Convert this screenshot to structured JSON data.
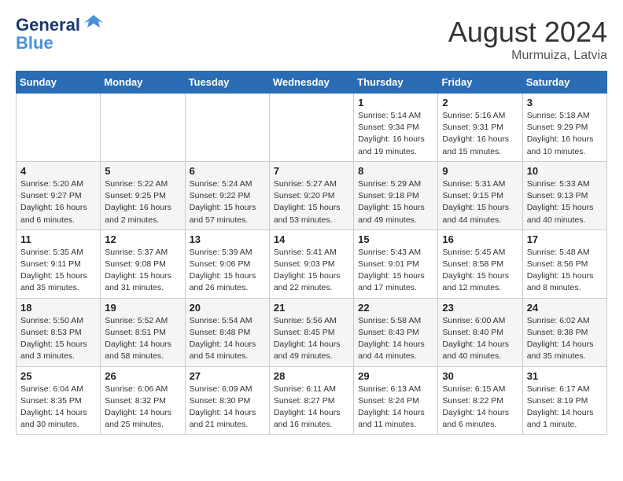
{
  "header": {
    "logo_line1": "General",
    "logo_line2": "Blue",
    "month_title": "August 2024",
    "location": "Murmuiza, Latvia"
  },
  "weekdays": [
    "Sunday",
    "Monday",
    "Tuesday",
    "Wednesday",
    "Thursday",
    "Friday",
    "Saturday"
  ],
  "weeks": [
    [
      {
        "day": "",
        "info": ""
      },
      {
        "day": "",
        "info": ""
      },
      {
        "day": "",
        "info": ""
      },
      {
        "day": "",
        "info": ""
      },
      {
        "day": "1",
        "info": "Sunrise: 5:14 AM\nSunset: 9:34 PM\nDaylight: 16 hours\nand 19 minutes."
      },
      {
        "day": "2",
        "info": "Sunrise: 5:16 AM\nSunset: 9:31 PM\nDaylight: 16 hours\nand 15 minutes."
      },
      {
        "day": "3",
        "info": "Sunrise: 5:18 AM\nSunset: 9:29 PM\nDaylight: 16 hours\nand 10 minutes."
      }
    ],
    [
      {
        "day": "4",
        "info": "Sunrise: 5:20 AM\nSunset: 9:27 PM\nDaylight: 16 hours\nand 6 minutes."
      },
      {
        "day": "5",
        "info": "Sunrise: 5:22 AM\nSunset: 9:25 PM\nDaylight: 16 hours\nand 2 minutes."
      },
      {
        "day": "6",
        "info": "Sunrise: 5:24 AM\nSunset: 9:22 PM\nDaylight: 15 hours\nand 57 minutes."
      },
      {
        "day": "7",
        "info": "Sunrise: 5:27 AM\nSunset: 9:20 PM\nDaylight: 15 hours\nand 53 minutes."
      },
      {
        "day": "8",
        "info": "Sunrise: 5:29 AM\nSunset: 9:18 PM\nDaylight: 15 hours\nand 49 minutes."
      },
      {
        "day": "9",
        "info": "Sunrise: 5:31 AM\nSunset: 9:15 PM\nDaylight: 15 hours\nand 44 minutes."
      },
      {
        "day": "10",
        "info": "Sunrise: 5:33 AM\nSunset: 9:13 PM\nDaylight: 15 hours\nand 40 minutes."
      }
    ],
    [
      {
        "day": "11",
        "info": "Sunrise: 5:35 AM\nSunset: 9:11 PM\nDaylight: 15 hours\nand 35 minutes."
      },
      {
        "day": "12",
        "info": "Sunrise: 5:37 AM\nSunset: 9:08 PM\nDaylight: 15 hours\nand 31 minutes."
      },
      {
        "day": "13",
        "info": "Sunrise: 5:39 AM\nSunset: 9:06 PM\nDaylight: 15 hours\nand 26 minutes."
      },
      {
        "day": "14",
        "info": "Sunrise: 5:41 AM\nSunset: 9:03 PM\nDaylight: 15 hours\nand 22 minutes."
      },
      {
        "day": "15",
        "info": "Sunrise: 5:43 AM\nSunset: 9:01 PM\nDaylight: 15 hours\nand 17 minutes."
      },
      {
        "day": "16",
        "info": "Sunrise: 5:45 AM\nSunset: 8:58 PM\nDaylight: 15 hours\nand 12 minutes."
      },
      {
        "day": "17",
        "info": "Sunrise: 5:48 AM\nSunset: 8:56 PM\nDaylight: 15 hours\nand 8 minutes."
      }
    ],
    [
      {
        "day": "18",
        "info": "Sunrise: 5:50 AM\nSunset: 8:53 PM\nDaylight: 15 hours\nand 3 minutes."
      },
      {
        "day": "19",
        "info": "Sunrise: 5:52 AM\nSunset: 8:51 PM\nDaylight: 14 hours\nand 58 minutes."
      },
      {
        "day": "20",
        "info": "Sunrise: 5:54 AM\nSunset: 8:48 PM\nDaylight: 14 hours\nand 54 minutes."
      },
      {
        "day": "21",
        "info": "Sunrise: 5:56 AM\nSunset: 8:45 PM\nDaylight: 14 hours\nand 49 minutes."
      },
      {
        "day": "22",
        "info": "Sunrise: 5:58 AM\nSunset: 8:43 PM\nDaylight: 14 hours\nand 44 minutes."
      },
      {
        "day": "23",
        "info": "Sunrise: 6:00 AM\nSunset: 8:40 PM\nDaylight: 14 hours\nand 40 minutes."
      },
      {
        "day": "24",
        "info": "Sunrise: 6:02 AM\nSunset: 8:38 PM\nDaylight: 14 hours\nand 35 minutes."
      }
    ],
    [
      {
        "day": "25",
        "info": "Sunrise: 6:04 AM\nSunset: 8:35 PM\nDaylight: 14 hours\nand 30 minutes."
      },
      {
        "day": "26",
        "info": "Sunrise: 6:06 AM\nSunset: 8:32 PM\nDaylight: 14 hours\nand 25 minutes."
      },
      {
        "day": "27",
        "info": "Sunrise: 6:09 AM\nSunset: 8:30 PM\nDaylight: 14 hours\nand 21 minutes."
      },
      {
        "day": "28",
        "info": "Sunrise: 6:11 AM\nSunset: 8:27 PM\nDaylight: 14 hours\nand 16 minutes."
      },
      {
        "day": "29",
        "info": "Sunrise: 6:13 AM\nSunset: 8:24 PM\nDaylight: 14 hours\nand 11 minutes."
      },
      {
        "day": "30",
        "info": "Sunrise: 6:15 AM\nSunset: 8:22 PM\nDaylight: 14 hours\nand 6 minutes."
      },
      {
        "day": "31",
        "info": "Sunrise: 6:17 AM\nSunset: 8:19 PM\nDaylight: 14 hours\nand 1 minute."
      }
    ]
  ]
}
